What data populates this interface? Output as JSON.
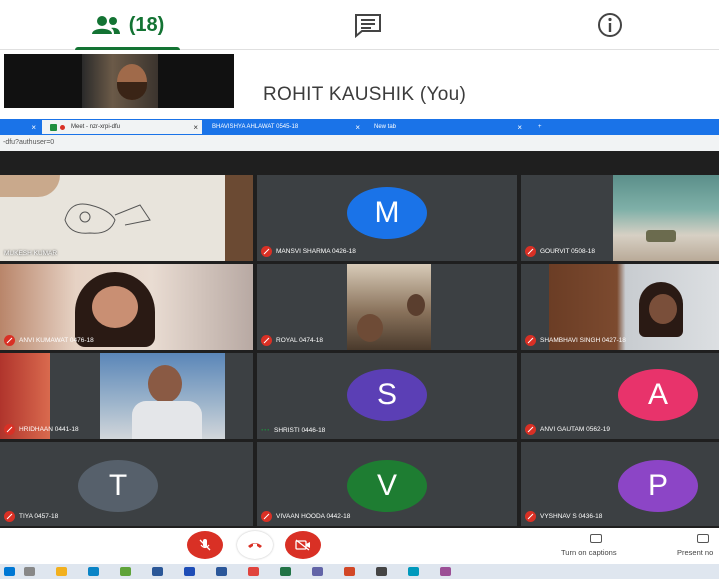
{
  "tabs": {
    "people_count": "(18)",
    "chat_icon": "chat-icon",
    "info_icon": "info-icon"
  },
  "self": {
    "name": "ROHIT KAUSHIK (You)"
  },
  "browser": {
    "tabs": [
      {
        "label": "Meet - nzr-xrpi-dfu",
        "close": "×"
      },
      {
        "label": "BHAVISHYA AHLAWAT 0545-18",
        "close": "×"
      },
      {
        "label": "New tab",
        "close": "×"
      }
    ],
    "new_tab": "+",
    "address": "-dfu?authuser=0"
  },
  "participants": [
    {
      "name": "MUKESH KUMAR",
      "status": "video-dim"
    },
    {
      "name": "MANSVI SHARMA 0426-18",
      "initial": "M",
      "color": "#1a73e8",
      "muted": true
    },
    {
      "name": "GOURVIT 0508-18",
      "muted": true
    },
    {
      "name": "ANVI KUMAWAT 0476-18",
      "muted": true
    },
    {
      "name": "ROYAL 0474-18",
      "muted": true
    },
    {
      "name": "SHAMBHAVI SINGH 0427-18",
      "muted": true
    },
    {
      "name": "HRIDHAAN 0441-18",
      "muted": true
    },
    {
      "name": "SHRISTI 0446-18",
      "initial": "S",
      "color": "#5b3fb5",
      "muted": false
    },
    {
      "name": "ANVI GAUTAM 0562-19",
      "initial": "A",
      "color": "#e8336b",
      "muted": true
    },
    {
      "name": "TIYA 0457-18",
      "initial": "T",
      "color": "#56606b",
      "muted": true
    },
    {
      "name": "VIVAAN HOODA 0442-18",
      "initial": "V",
      "color": "#1e7d32",
      "muted": true
    },
    {
      "name": "VYSHNAV S 0436-18",
      "initial": "P",
      "color": "#8c45c6",
      "muted": true
    }
  ],
  "controls": {
    "captions_label": "Turn on captions",
    "present_label": "Present no"
  }
}
